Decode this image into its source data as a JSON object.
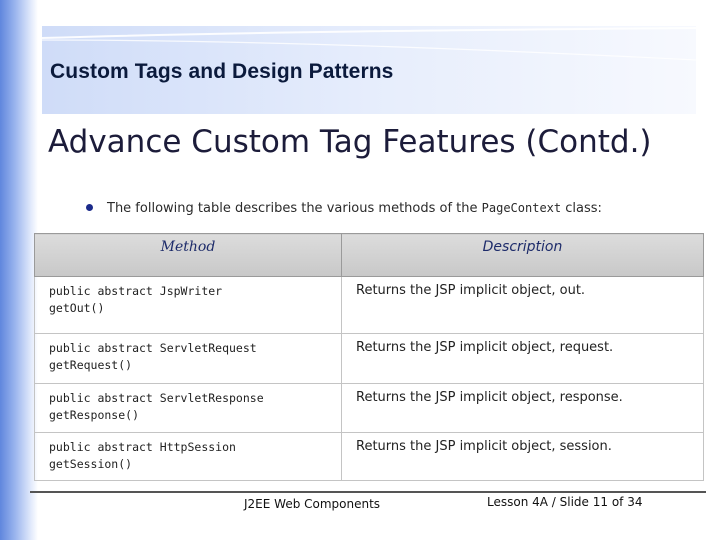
{
  "header": {
    "title": "Custom Tags and Design Patterns"
  },
  "slide": {
    "title": "Advance Custom Tag Features (Contd.)",
    "bullet": {
      "text_before": "The following table describes the various methods of the ",
      "code": "PageContext",
      "text_after": " class:"
    }
  },
  "table": {
    "headers": [
      "Method",
      "Description"
    ],
    "rows": [
      {
        "method_line1": "public abstract JspWriter",
        "method_line2": "getOut()",
        "description": "Returns the JSP implicit object, out."
      },
      {
        "method_line1": "public abstract ServletRequest",
        "method_line2": "getRequest()",
        "description": "Returns the JSP implicit object, request."
      },
      {
        "method_line1": "public abstract ServletResponse",
        "method_line2": "getResponse()",
        "description": "Returns the JSP implicit object, response."
      },
      {
        "method_line1": "public abstract HttpSession",
        "method_line2": "getSession()",
        "description": "Returns the JSP implicit object, session."
      }
    ]
  },
  "footer": {
    "course": "J2EE Web Components",
    "slide_info": "Lesson 4A / Slide 11 of 34"
  },
  "colors": {
    "sidebar_accent": "#5f86dd",
    "header_band": "#cfdcf8",
    "bullet": "#1b2a8a",
    "table_header_text": "#1d2b6a"
  }
}
